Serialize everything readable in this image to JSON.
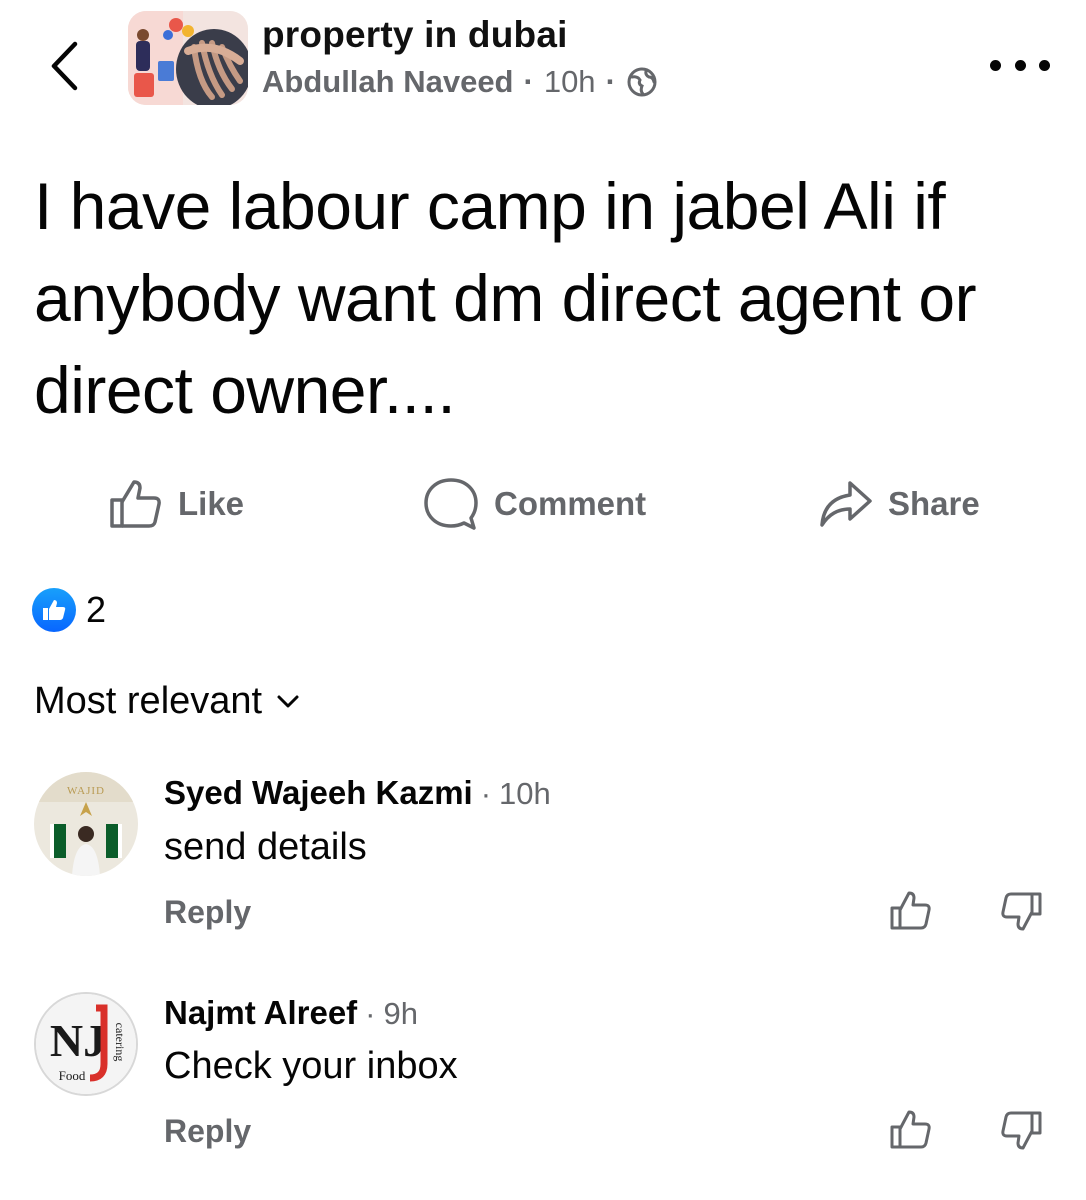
{
  "header": {
    "group_name": "property in dubai",
    "author": "Abdullah Naveed",
    "separator": "·",
    "time": "10h"
  },
  "post": {
    "text": "I have labour camp in jabel Ali if anybody want dm direct agent or direct owner...."
  },
  "actions": {
    "like": "Like",
    "comment": "Comment",
    "share": "Share"
  },
  "reactions": {
    "count": "2"
  },
  "sort": {
    "label": "Most relevant"
  },
  "comments": [
    {
      "author": "Syed Wajeeh Kazmi",
      "time": "10h",
      "text": "send details",
      "reply": "Reply",
      "avatar_text": "WAJID"
    },
    {
      "author": "Najmt Alreef",
      "time": "9h",
      "text": "Check your inbox",
      "reply": "Reply",
      "avatar_logo": "NJ",
      "avatar_food": "Food",
      "avatar_catering": "catering"
    }
  ],
  "colors": {
    "secondary_text": "#65676b",
    "primary_text": "#050505",
    "like_blue": "#0866ff"
  }
}
